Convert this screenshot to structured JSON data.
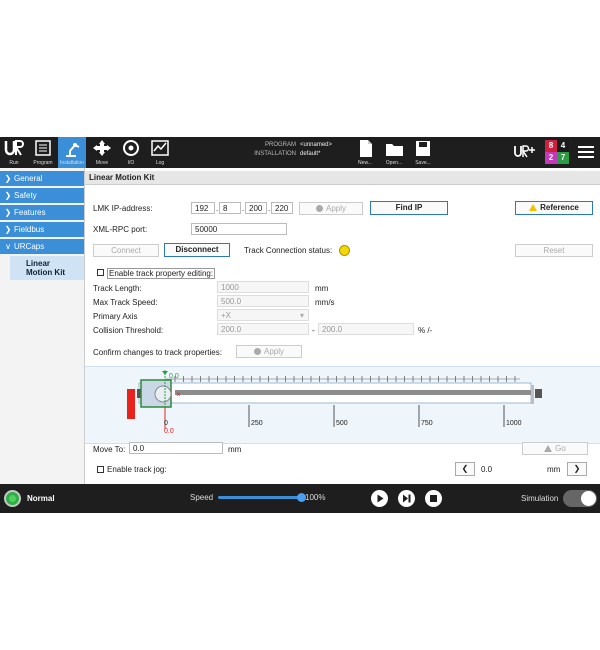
{
  "topbar": {
    "run": "Run",
    "program": "Program",
    "installation": "Installation",
    "move": "Move",
    "io": "I/O",
    "log": "Log",
    "program_label": "PROGRAM",
    "program_value": "<unnamed>",
    "installation_label": "INSTALLATION",
    "installation_value": "default*",
    "new": "New...",
    "open": "Open...",
    "save": "Save...",
    "badge_values": [
      "8",
      "4",
      "2",
      "7"
    ],
    "badge_colors": [
      "#d0203d",
      "#1a1a1a",
      "#c23ab8",
      "#2a9e45"
    ]
  },
  "sidebar": {
    "items": [
      {
        "label": "General"
      },
      {
        "label": "Safety"
      },
      {
        "label": "Features"
      },
      {
        "label": "Fieldbus"
      },
      {
        "label": "URCaps"
      }
    ],
    "sub_item_line1": "Linear",
    "sub_item_line2": "Motion Kit"
  },
  "main": {
    "title": "Linear Motion Kit",
    "ip_label": "LMK IP-address:",
    "ip_octets": [
      "192",
      "8",
      "200",
      "220"
    ],
    "apply": "Apply",
    "find_ip": "Find IP",
    "reference": "Reference",
    "rpc_label": "XML-RPC port:",
    "rpc_value": "50000",
    "connect": "Connect",
    "disconnect": "Disconnect",
    "track_status_label": "Track Connection status:",
    "reset": "Reset",
    "enable_editing": "Enable track property editing:",
    "track_length_label": "Track Length:",
    "track_length_value": "1000",
    "track_length_unit": "mm",
    "max_speed_label": "Max Track Speed:",
    "max_speed_value": "500.0",
    "max_speed_unit": "mm/s",
    "primary_axis_label": "Primary Axis",
    "primary_axis_value": "+X",
    "collision_label": "Collision Threshold:",
    "collision_low": "200.0",
    "collision_dash": "-",
    "collision_high": "200.0",
    "collision_unit": "% /-",
    "confirm_label": "Confirm changes to track properties:",
    "confirm_apply": "Apply",
    "track": {
      "top_value": "0.0",
      "bottom_value": "0",
      "bottom_red_value": "0.0",
      "tick_labels": [
        "250",
        "500",
        "750",
        "1000"
      ]
    },
    "move_to_label": "Move To:",
    "move_to_value": "0.0",
    "move_to_unit": "mm",
    "go": "Go",
    "jog_label": "Enable track jog:",
    "jog_value": "0.0",
    "jog_unit": "mm"
  },
  "bottombar": {
    "status": "Normal",
    "speed_label": "Speed",
    "speed_value": "100%",
    "speed_fraction": 1.0,
    "simulation_label": "Simulation"
  }
}
